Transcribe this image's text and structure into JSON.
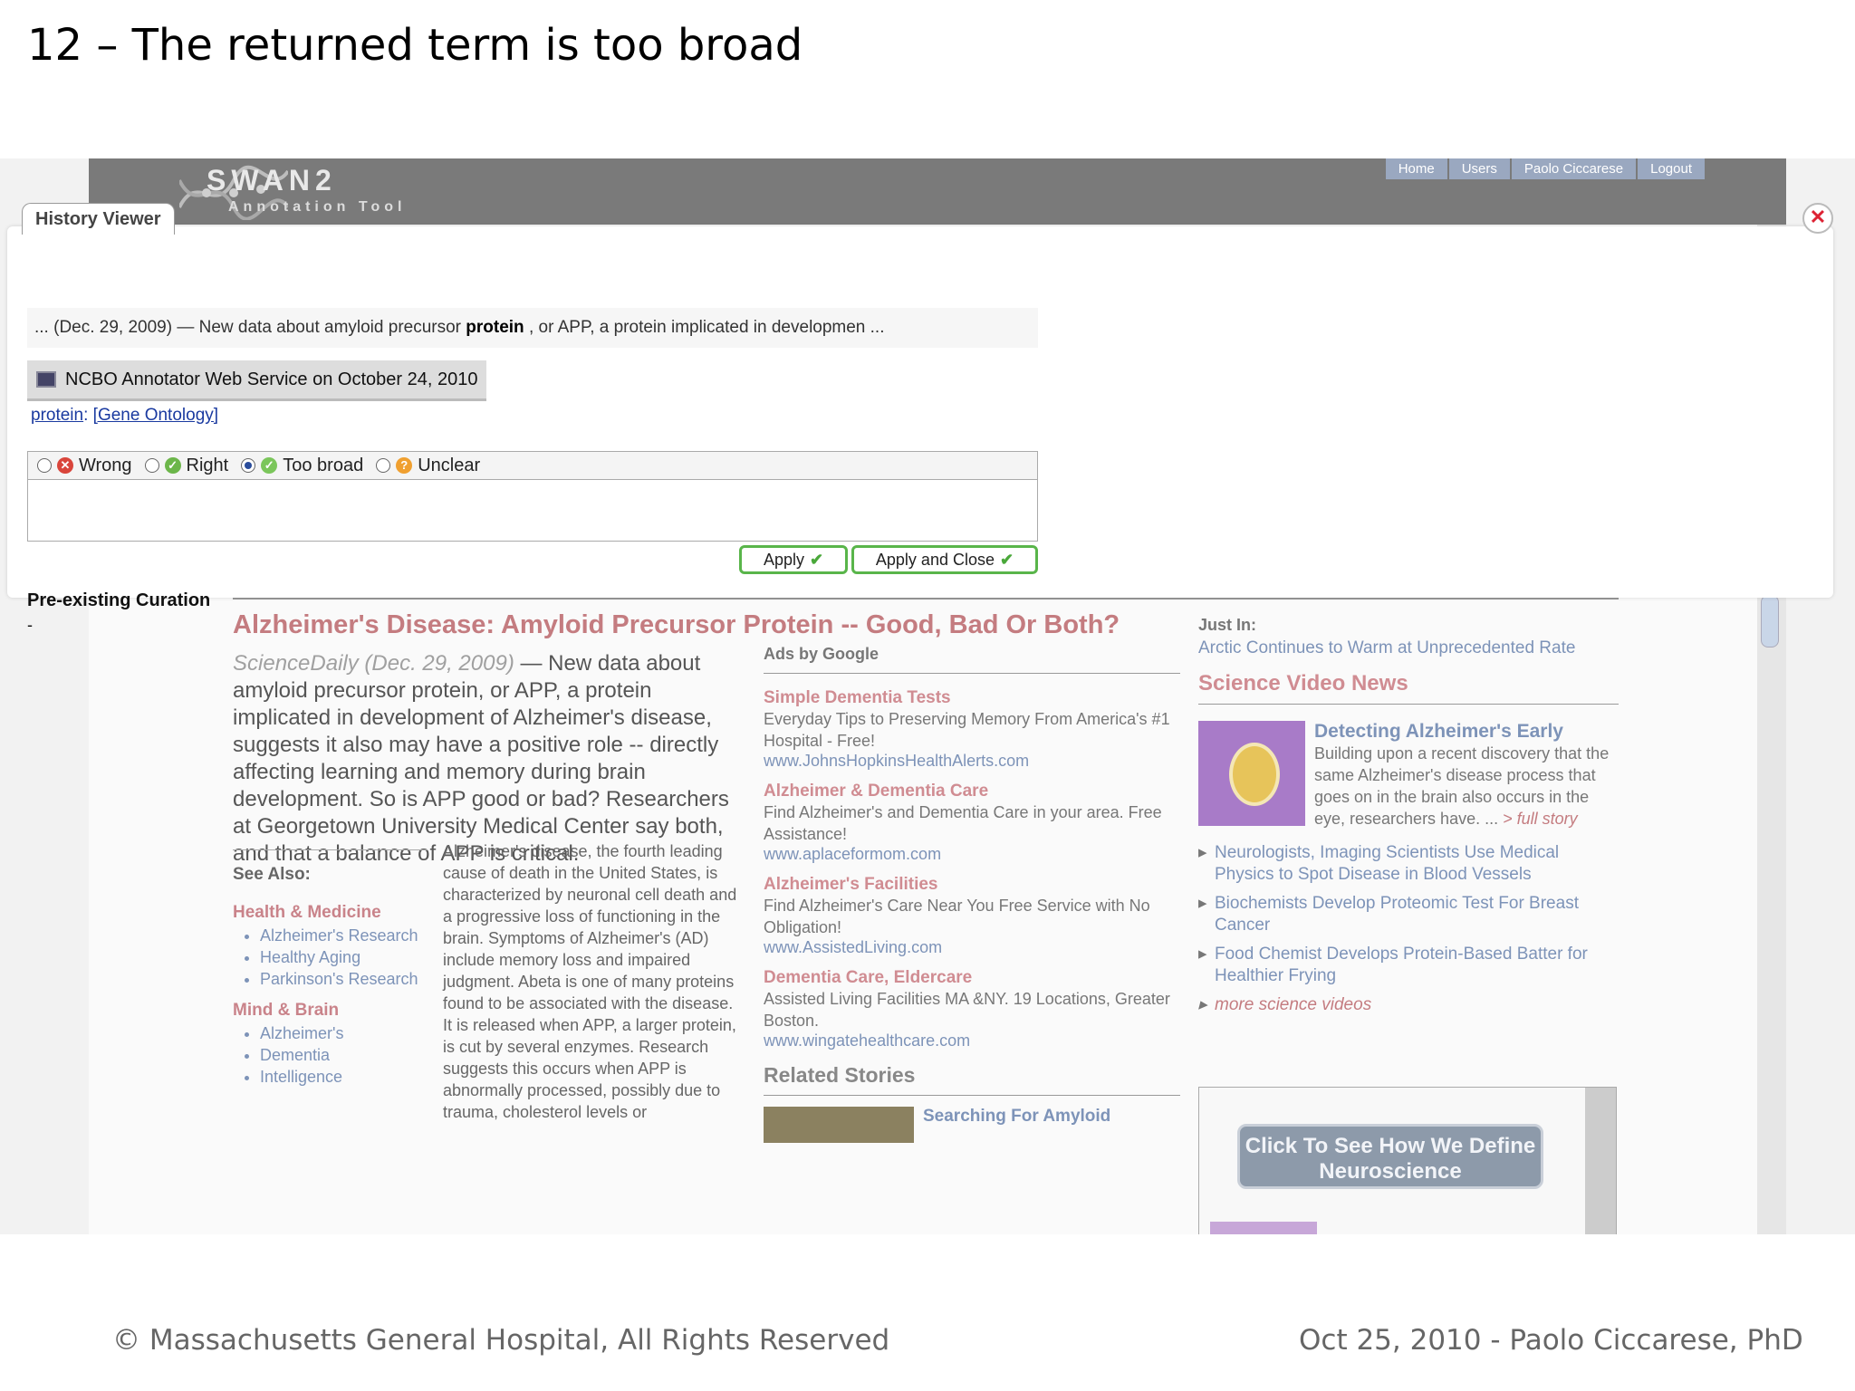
{
  "slide": {
    "title": "12 – The returned term is too broad",
    "footer_left": "© Massachusetts General Hospital, All Rights Reserved",
    "footer_right": "Oct 25, 2010 - Paolo Ciccarese, PhD"
  },
  "app": {
    "name": "SWAN2",
    "subtitle": "Annotation Tool",
    "nav": [
      "Home",
      "Users",
      "Paolo Ciccarese",
      "Logout"
    ]
  },
  "dialog": {
    "tab_label": "History Viewer",
    "snippet_before": "... (Dec. 29, 2009) — New data about amyloid precursor ",
    "snippet_term": "protein",
    "snippet_after": " , or APP, a protein implicated in developmen ...",
    "source_label": "NCBO Annotator Web Service on October 24, 2010",
    "term": "protein",
    "term_sep": ": ",
    "ontology": "[Gene Ontology]",
    "choices": [
      {
        "label": "Wrong",
        "selected": false,
        "icon": "x-icon"
      },
      {
        "label": "Right",
        "selected": false,
        "icon": "check-icon"
      },
      {
        "label": "Too broad",
        "selected": true,
        "icon": "check-icon"
      },
      {
        "label": "Unclear",
        "selected": false,
        "icon": "question-icon"
      }
    ],
    "apply_label": "Apply",
    "apply_close_label": "Apply and Close",
    "preexisting_label": "Pre-existing Curation",
    "preexisting_value": "-"
  },
  "article": {
    "headline": "Alzheimer's Disease: Amyloid Precursor Protein -- Good, Bad Or Both?",
    "lead_source": "ScienceDaily (Dec. 29, 2009)",
    "lead_text": " — New data about amyloid precursor protein, or APP, a protein implicated in development of Alzheimer's disease, suggests it also may have a positive role -- directly affecting learning and memory during brain development. So is APP good or bad? Researchers at Georgetown University Medical Center say both, and that a balance of APP is critical.",
    "see_also": "See Also:",
    "cat1": "Health & Medicine",
    "cat1_items": [
      "Alzheimer's Research",
      "Healthy Aging",
      "Parkinson's Research"
    ],
    "cat2": "Mind & Brain",
    "cat2_items": [
      "Alzheimer's",
      "Dementia",
      "Intelligence"
    ],
    "body": "Alzheimer's disease, the fourth leading cause of death in the United States, is characterized by neuronal cell death and a progressive loss of functioning in the brain. Symptoms of Alzheimer's (AD) include memory loss and impaired judgment. Abeta is one of many proteins found to be associated with the disease. It is released when APP, a larger protein, is cut by several enzymes. Research suggests this occurs when APP is abnormally processed, possibly due to trauma, cholesterol levels or"
  },
  "ads": {
    "label": "Ads by Google",
    "items": [
      {
        "title": "Simple Dementia Tests",
        "desc": "Everyday Tips to Preserving Memory From America's #1 Hospital - Free!",
        "url": "www.JohnsHopkinsHealthAlerts.com"
      },
      {
        "title": "Alzheimer & Dementia Care",
        "desc": "Find Alzheimer's and Dementia Care in your area. Free Assistance!",
        "url": "www.aplaceformom.com"
      },
      {
        "title": "Alzheimer's Facilities",
        "desc": "Find Alzheimer's Care Near You Free Service with No Obligation!",
        "url": "www.AssistedLiving.com"
      },
      {
        "title": "Dementia Care, Eldercare",
        "desc": "Assisted Living Facilities MA &NY. 19 Locations, Greater Boston.",
        "url": "www.wingatehealthcare.com"
      }
    ],
    "related": "Related Stories",
    "related_item": "Searching For Amyloid"
  },
  "sidebar": {
    "just_in": "Just In:",
    "just_in_link": "Arctic Continues to Warm at Unprecedented Rate",
    "video_heading": "Science Video News",
    "feature_title": "Detecting Alzheimer's Early",
    "feature_desc": "Building upon a recent discovery that the same Alzheimer's disease process that goes on in the brain also occurs in the eye, researchers have. ... ",
    "feature_more": "> full story",
    "videos": [
      "Neurologists, Imaging Scientists Use Medical Physics to Spot Disease in Blood Vessels",
      "Biochemists Develop Proteomic Test For Breast Cancer",
      "Food Chemist Develops Protein-Based Batter for Healthier Frying"
    ],
    "more_videos": "more science videos",
    "promo": "Click To See How We Define Neuroscience"
  }
}
